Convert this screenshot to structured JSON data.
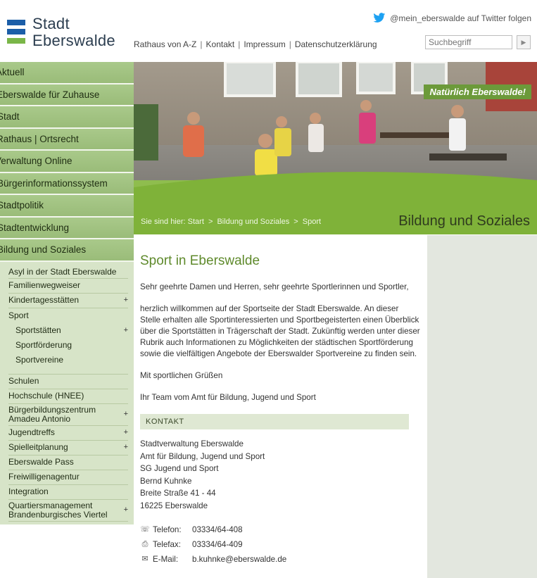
{
  "header": {
    "logo_line1": "Stadt",
    "logo_line2": "Eberswalde",
    "twitter_text": "@mein_eberswalde auf Twitter folgen",
    "links": [
      "Rathaus von A-Z",
      "Kontakt",
      "Impressum",
      "Datenschutzerklärung"
    ],
    "search_placeholder": "Suchbegriff",
    "search_button_icon": "play-triangle-icon"
  },
  "colors": {
    "logo_blue": "#1b5ea8",
    "logo_green": "#7ab648",
    "nav_green": "#9abc79",
    "subnav_bg": "#d7e4c8",
    "title_green": "#5f8a2c",
    "accent_bar": "#7fb239"
  },
  "main_nav": [
    "Aktuell",
    "Eberswalde für Zuhause",
    "Stadt",
    "Rathaus | Ortsrecht",
    "Verwaltung Online",
    "Bürgerinformationssystem",
    "Stadtpolitik",
    "Stadtentwicklung",
    "Bildung und Soziales"
  ],
  "sub_nav": {
    "asyl": "Asyl in der Stadt Eberswalde",
    "familie": "Familienwegweiser",
    "kita": "Kindertagesstätten",
    "sport": "Sport",
    "sportstaetten": "Sportstätten",
    "sportfoerderung": "Sportförderung",
    "sportvereine": "Sportvereine",
    "schulen": "Schulen",
    "hochschule": "Hochschule (HNEE)",
    "bbz": "Bürgerbildungszentrum Amadeu Antonio",
    "jugendtreffs": "Jugendtreffs",
    "spielleit": "Spielleitplanung",
    "pass": "Eberswalde Pass",
    "freiwillig": "Freiwilligenagentur",
    "integration": "Integration",
    "quartier": "Quartiersmanagement Brandenburgisches Viertel",
    "plus": "+"
  },
  "banner": {
    "slogan_italic": "Natürlich",
    "slogan_rest": " Eberswalde!",
    "breadcrumb_prefix": "Sie sind hier:",
    "breadcrumb": [
      "Start",
      "Bildung und Soziales",
      "Sport"
    ],
    "breadcrumb_sep": ">",
    "section_title": "Bildung und Soziales"
  },
  "content": {
    "title": "Sport in Eberswalde",
    "greeting": "Sehr geehrte Damen und Herren, sehr geehrte Sportlerinnen und Sportler,",
    "intro": "herzlich willkommen auf der Sportseite der Stadt Eberswalde. An dieser Stelle erhalten alle Sportinteressierten und Sportbegeisterten einen Überblick über die Sportstätten in Trägerschaft der Stadt. Zukünftig werden unter dieser Rubrik auch Informationen zu Möglichkeiten der städtischen Sportförderung sowie die vielfältigen Angebote der Eberswalder Sportvereine zu finden sein.",
    "closing": "Mit sportlichen Grüßen",
    "signature": "Ihr Team vom Amt für Bildung, Jugend und Sport",
    "kontakt_heading": "KONTAKT",
    "address": [
      "Stadtverwaltung Eberswalde",
      "Amt für Bildung, Jugend und Sport",
      "SG Jugend und Sport",
      "Bernd Kuhnke",
      "Breite Straße 41 - 44",
      "16225 Eberswalde"
    ],
    "phone_label": "Telefon:",
    "phone": "03334/64-408",
    "fax_label": "Telefax:",
    "fax": "03334/64-409",
    "email_label": "E-Mail:",
    "email": "b.kuhnke@eberswalde.de"
  }
}
